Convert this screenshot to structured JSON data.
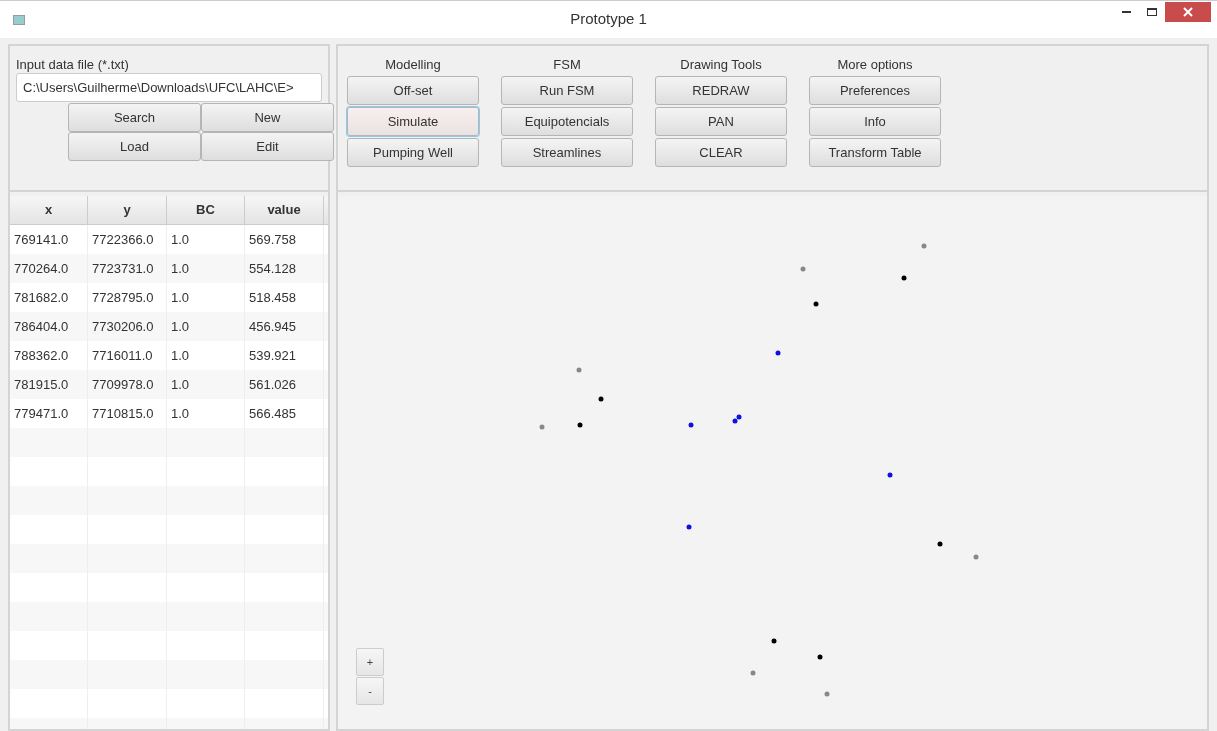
{
  "window": {
    "title": "Prototype 1"
  },
  "input_file": {
    "label": "Input data file (*.txt)",
    "value": "C:\\Users\\Guilherme\\Downloads\\UFC\\LAHC\\E>",
    "buttons": [
      "Search",
      "New",
      "Load",
      "Edit"
    ]
  },
  "table": {
    "columns": [
      "x",
      "y",
      "BC",
      "value"
    ],
    "rows": [
      [
        "769141.0",
        "7722366.0",
        "1.0",
        "569.758"
      ],
      [
        "770264.0",
        "7723731.0",
        "1.0",
        "554.128"
      ],
      [
        "781682.0",
        "7728795.0",
        "1.0",
        "518.458"
      ],
      [
        "786404.0",
        "7730206.0",
        "1.0",
        "456.945"
      ],
      [
        "788362.0",
        "7716011.0",
        "1.0",
        "539.921"
      ],
      [
        "781915.0",
        "7709978.0",
        "1.0",
        "561.026"
      ],
      [
        "779471.0",
        "7710815.0",
        "1.0",
        "566.485"
      ]
    ]
  },
  "toolbar": [
    {
      "title": "Modelling",
      "buttons": [
        {
          "label": "Off-set",
          "focused": false
        },
        {
          "label": "Simulate",
          "focused": true
        },
        {
          "label": "Pumping Well",
          "focused": false
        }
      ]
    },
    {
      "title": "FSM",
      "buttons": [
        {
          "label": "Run FSM",
          "focused": false
        },
        {
          "label": "Equipotencials",
          "focused": false
        },
        {
          "label": "Streamlines",
          "focused": false
        }
      ]
    },
    {
      "title": "Drawing Tools",
      "buttons": [
        {
          "label": "REDRAW",
          "focused": false
        },
        {
          "label": "PAN",
          "focused": false
        },
        {
          "label": "CLEAR",
          "focused": false
        }
      ]
    },
    {
      "title": "More options",
      "buttons": [
        {
          "label": "Preferences",
          "focused": false
        },
        {
          "label": "Info",
          "focused": false
        },
        {
          "label": "Transform Table",
          "focused": false
        }
      ]
    }
  ],
  "zoom_buttons": [
    "+",
    "-"
  ]
}
